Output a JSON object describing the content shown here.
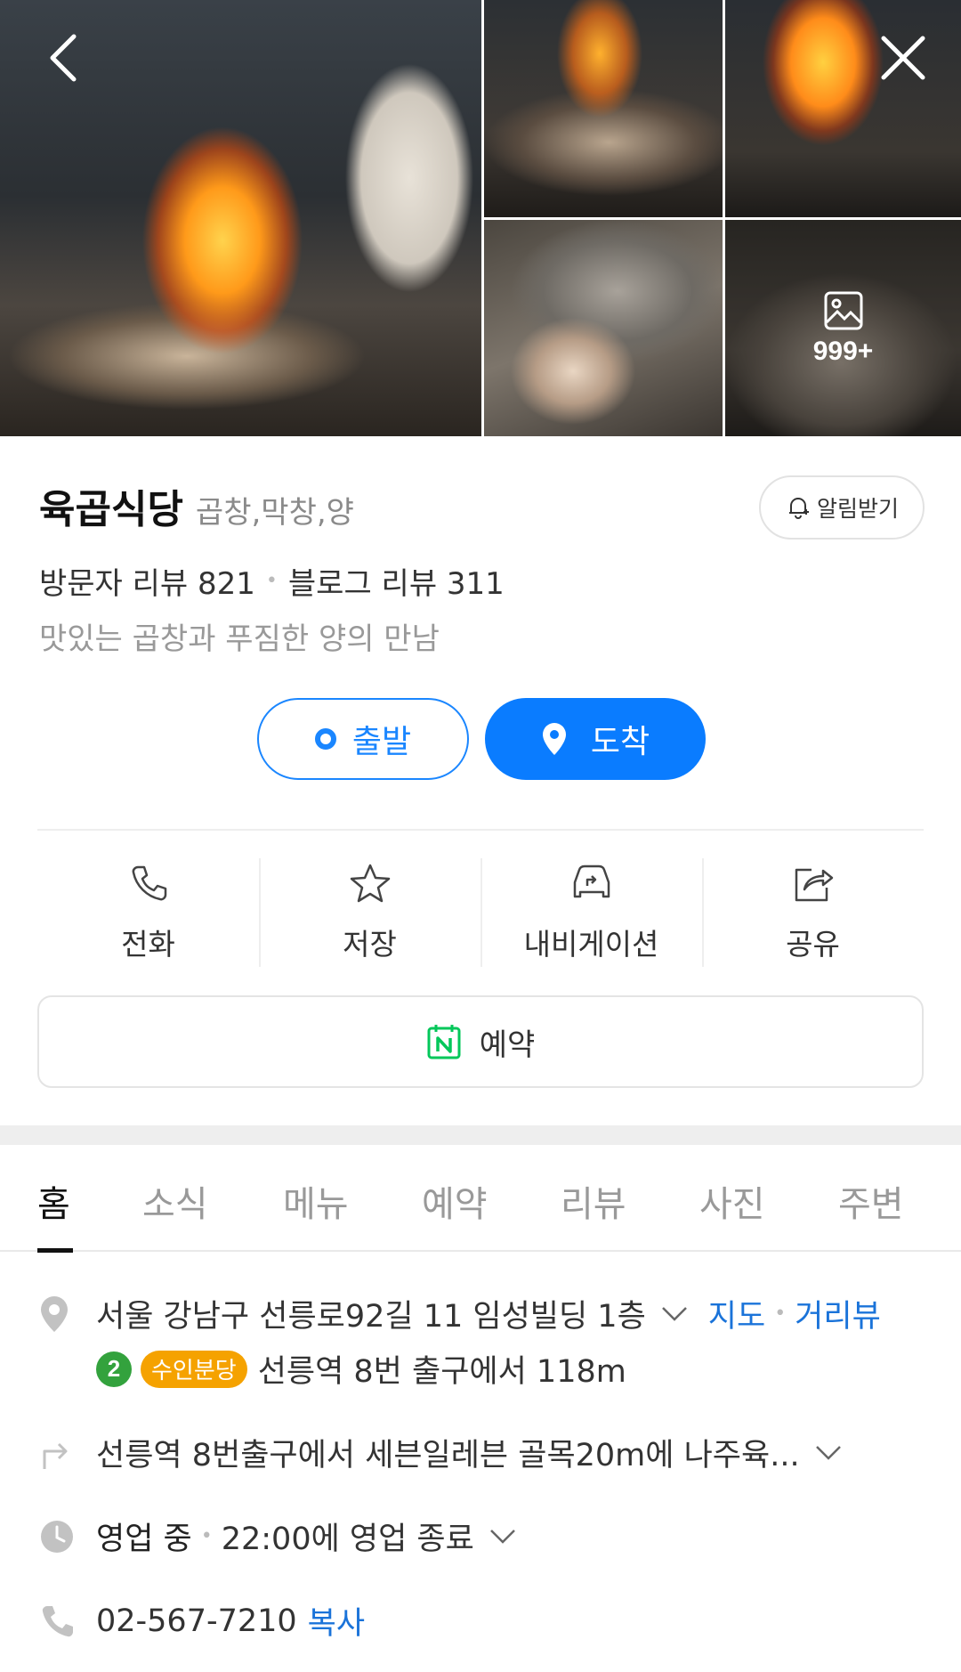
{
  "gallery": {
    "more_count": "999+",
    "photos": [
      "main-flame-photo",
      "grill-tongs-photo",
      "flame-closeup-photo",
      "gopchang-closeup-photo",
      "grill-more-photo"
    ]
  },
  "place": {
    "name": "육곱식당",
    "category": "곱창,막창,양",
    "alert_label": "알림받기",
    "visitor_reviews": "방문자 리뷰 821",
    "blog_reviews": "블로그 리뷰 311",
    "separator": "•",
    "description": "맛있는 곱창과 푸짐한 양의 만남"
  },
  "route": {
    "depart_label": "출발",
    "arrive_label": "도착"
  },
  "actions": [
    {
      "label": "전화",
      "icon": "phone-icon"
    },
    {
      "label": "저장",
      "icon": "star-icon"
    },
    {
      "label": "내비게이션",
      "icon": "car-navigation-icon"
    },
    {
      "label": "공유",
      "icon": "share-icon"
    }
  ],
  "reserve": {
    "label": "예약",
    "icon": "naver-calendar-icon"
  },
  "tabs": [
    "홈",
    "소식",
    "메뉴",
    "예약",
    "리뷰",
    "사진",
    "주변"
  ],
  "details": {
    "address": "서울 강남구 선릉로92길 11 임성빌딩 1층",
    "map_link": "지도",
    "street_view_link": "거리뷰",
    "subway_line": "2",
    "subway_branch": "수인분당",
    "subway_distance": "선릉역 8번 출구에서 118m",
    "directions": "선릉역 8번출구에서 세븐일레븐 골목20m에 나주육...",
    "hours_status": "영업 중",
    "hours_detail": "22:00에 영업 종료",
    "phone": "02-567-7210",
    "copy_label": "복사"
  },
  "colors": {
    "accent_blue": "#0a7cff",
    "link_blue": "#1a73d9",
    "line2_green": "#33a23d",
    "suin_bundang_yellow": "#f5a200",
    "naver_green": "#03c75a"
  }
}
